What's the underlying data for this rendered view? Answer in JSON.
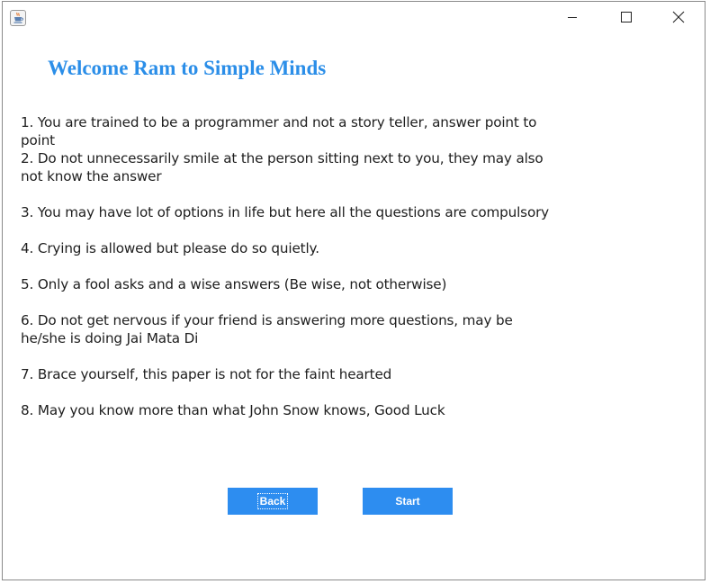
{
  "window": {
    "icon": "java-coffee-cup-icon",
    "controls": {
      "minimize": "minimize-icon",
      "maximize": "maximize-icon",
      "close": "close-icon"
    }
  },
  "heading": "Welcome Ram to Simple Minds",
  "rules": [
    "1. You are trained to be a programmer and not a story teller, answer point to point",
    "2. Do not unnecessarily smile at the person sitting next to you, they may also not know the answer",
    "3. You may have lot of options in life but here all the questions are compulsory",
    "4. Crying is allowed but please do so quietly.",
    "5. Only a fool asks and a wise answers (Be wise, not otherwise)",
    "6. Do not get nervous if your friend is answering more questions, may be he/she is doing Jai Mata Di",
    "7. Brace yourself, this paper is not for the faint hearted",
    "8. May you know more than what John Snow knows, Good Luck"
  ],
  "buttons": {
    "back_label": "Back",
    "start_label": "Start"
  },
  "colors": {
    "accent": "#2b8ee8",
    "button": "#2d8df0",
    "text": "#1e1e1e"
  }
}
